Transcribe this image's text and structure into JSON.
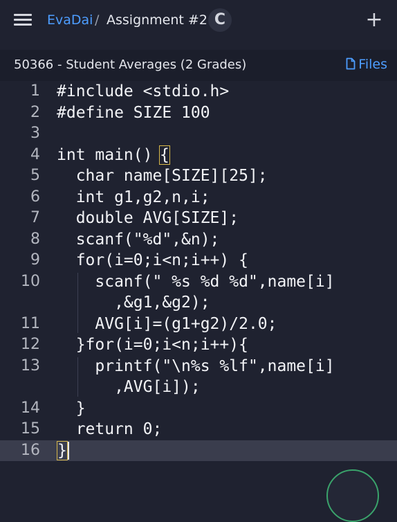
{
  "header": {
    "user": "EvaDai",
    "separator": "/",
    "title": "Assignment #2",
    "lang_icon": "C",
    "add_label": "+"
  },
  "subheader": {
    "problem_title": "50366 - Student Averages (2 Grades)",
    "files_label": "Files"
  },
  "editor": {
    "lines": [
      {
        "num": "1",
        "code": "#include <stdio.h>"
      },
      {
        "num": "2",
        "code": "#define SIZE 100"
      },
      {
        "num": "3",
        "code": ""
      },
      {
        "num": "4",
        "code": "int main()",
        "bracket": "{"
      },
      {
        "num": "5",
        "code": "  char name[SIZE][25];"
      },
      {
        "num": "6",
        "code": "  int g1,g2,n,i;"
      },
      {
        "num": "7",
        "code": "  double AVG[SIZE];"
      },
      {
        "num": "8",
        "code": "  scanf(\"%d\",&n);"
      },
      {
        "num": "9",
        "code": "  for(i=0;i<n;i++) {"
      },
      {
        "num": "10",
        "code": "    scanf(\" %s %d %d\",name[i]"
      },
      {
        "num": "",
        "code": "      ,&g1,&g2);"
      },
      {
        "num": "11",
        "code": "    AVG[i]=(g1+g2)/2.0;"
      },
      {
        "num": "12",
        "code": "  }for(i=0;i<n;i++){"
      },
      {
        "num": "13",
        "code": "    printf(\"\\n%s %lf\",name[i]"
      },
      {
        "num": "",
        "code": "      ,AVG[i]);"
      },
      {
        "num": "14",
        "code": "  }"
      },
      {
        "num": "15",
        "code": "  return 0;"
      },
      {
        "num": "16",
        "code": "",
        "bracket": "}"
      }
    ],
    "active_line": "16"
  }
}
